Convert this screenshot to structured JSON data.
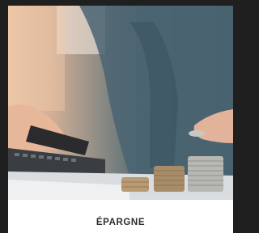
{
  "card": {
    "title": "ÉPARGNE",
    "image_icon": "savings-coins-photo"
  }
}
